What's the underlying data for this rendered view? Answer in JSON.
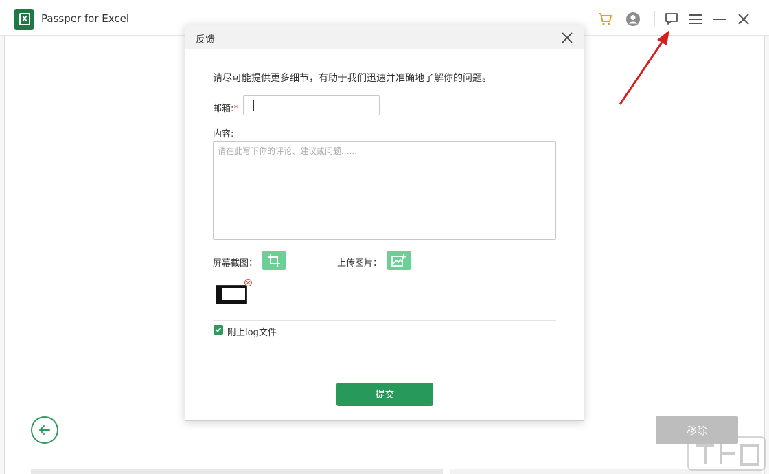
{
  "app": {
    "title": "Passper for Excel",
    "logo_letter": "X"
  },
  "titlebar": {
    "icons": [
      "cart-icon",
      "account-icon",
      "feedback-icon",
      "menu-icon",
      "minimize-icon",
      "close-icon"
    ],
    "cart_color": "#f39c12"
  },
  "dialog": {
    "title": "反馈",
    "intro": "请尽可能提供更多细节，有助于我们迅速并准确地了解你的问题。",
    "email_label": "邮箱:",
    "email_required_mark": "*",
    "email_value": "",
    "content_label": "内容:",
    "content_placeholder": "请在此写下你的评论、建议或问题......",
    "screenshot_label": "屏幕截图：",
    "upload_label": "上传图片：",
    "attach_log_label": "附上log文件",
    "attach_log_checked": true,
    "submit_label": "提交"
  },
  "page": {
    "remove_label": "移除"
  },
  "colors": {
    "brand_green": "#27995a",
    "light_green": "#6ccf96",
    "required_red": "#e74c3c",
    "arrow_red": "#d62020"
  }
}
